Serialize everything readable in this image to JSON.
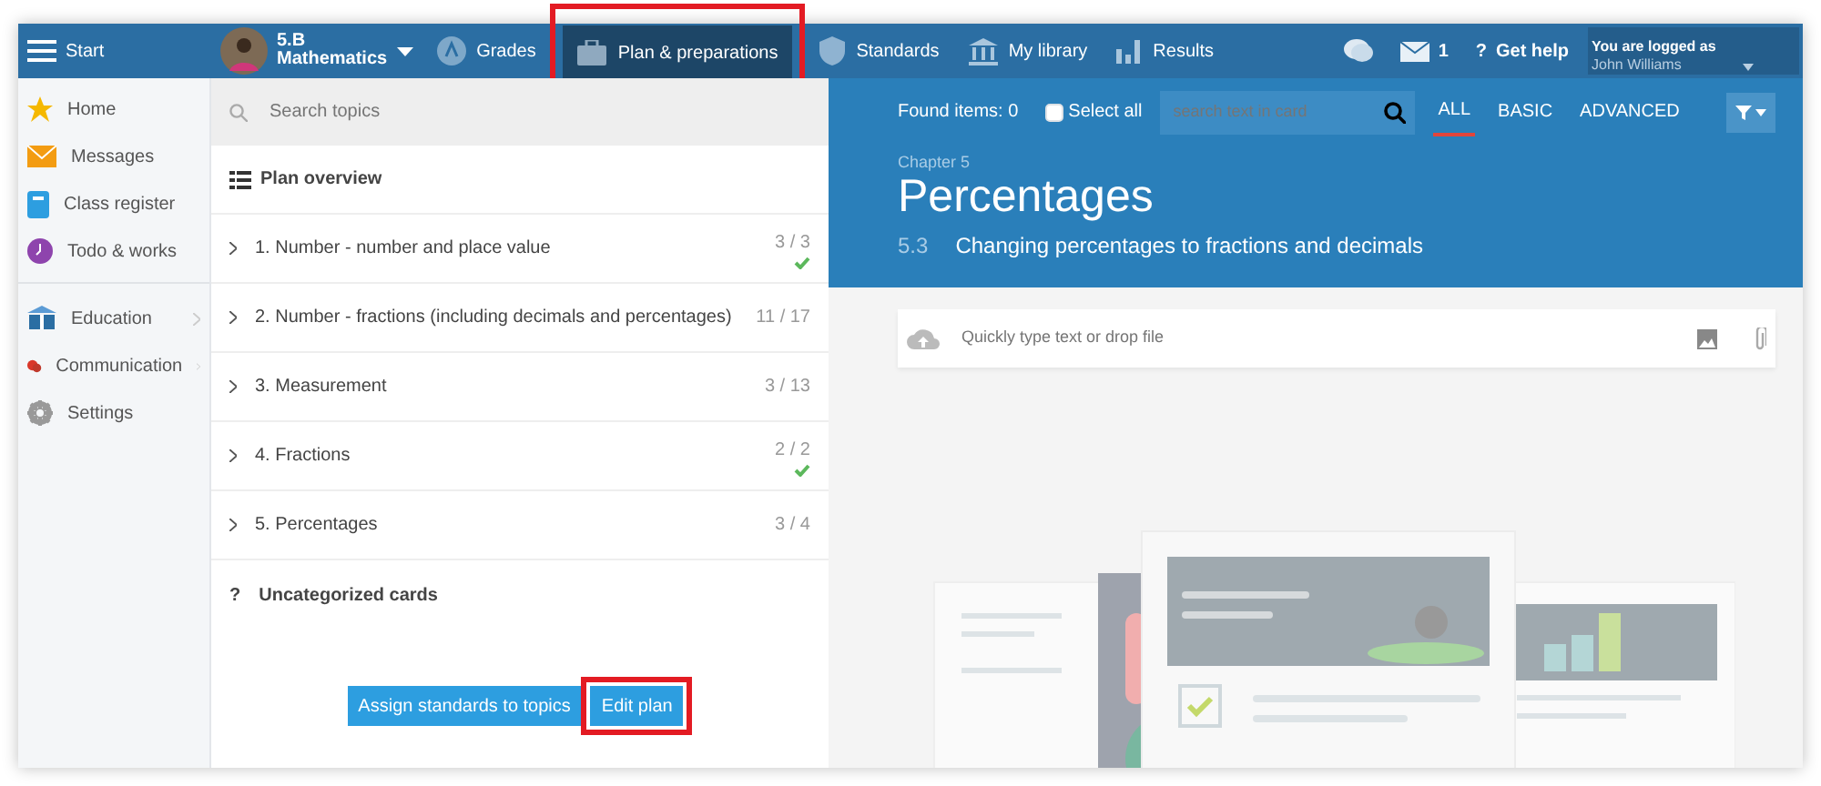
{
  "nav": {
    "start": "Start",
    "class_name": "5.B",
    "subject": "Mathematics",
    "items": [
      {
        "label": "Grades",
        "selected": false,
        "highlighted": false
      },
      {
        "label": "Plan & preparations",
        "selected": true,
        "highlighted": true
      },
      {
        "label": "Standards",
        "selected": false,
        "highlighted": false
      },
      {
        "label": "My library",
        "selected": false,
        "highlighted": false
      },
      {
        "label": "Results",
        "selected": false,
        "highlighted": false
      }
    ],
    "messages_count": "1",
    "help_icon": "?",
    "help": "Get help",
    "login_label": "You are logged as",
    "user": "John Williams"
  },
  "sidebar": {
    "groups": [
      [
        {
          "label": "Home",
          "submenu": false
        },
        {
          "label": "Messages",
          "submenu": false
        },
        {
          "label": "Class register",
          "submenu": false
        },
        {
          "label": "Todo & works",
          "submenu": false
        }
      ],
      [
        {
          "label": "Education",
          "submenu": true
        },
        {
          "label": "Communication",
          "submenu": true
        },
        {
          "label": "Settings",
          "submenu": false
        }
      ]
    ]
  },
  "topics": {
    "search_placeholder": "Search topics",
    "title": "Plan overview",
    "items": [
      {
        "label": "1. Number - number and place value",
        "count": "3 / 3",
        "complete": true
      },
      {
        "label": "2. Number - fractions (including decimals and percentages)",
        "count": "11 / 17",
        "complete": false
      },
      {
        "label": "3. Measurement",
        "count": "3 / 13",
        "complete": false
      },
      {
        "label": "4. Fractions",
        "count": "2 / 2",
        "complete": true
      },
      {
        "label": "5. Percentages",
        "count": "3 / 4",
        "complete": false
      }
    ],
    "uncategorized_mark": "?",
    "uncategorized": "Uncategorized cards",
    "buttons": [
      {
        "label": "Assign standards to topics",
        "highlighted": false
      },
      {
        "label": "Edit plan",
        "highlighted": true
      }
    ]
  },
  "content": {
    "found": "Found items: 0",
    "select_all": {
      "label": "Select all",
      "checked": false
    },
    "search_placeholder": "search text in card",
    "filters": [
      {
        "label": "ALL",
        "selected": true
      },
      {
        "label": "BASIC",
        "selected": false
      },
      {
        "label": "ADVANCED",
        "selected": false
      }
    ],
    "chapter": "Chapter 5",
    "title": "Percentages",
    "section_number": "5.3",
    "section_title": "Changing percentages to fractions and decimals",
    "quick_placeholder": "Quickly type text or drop file"
  }
}
